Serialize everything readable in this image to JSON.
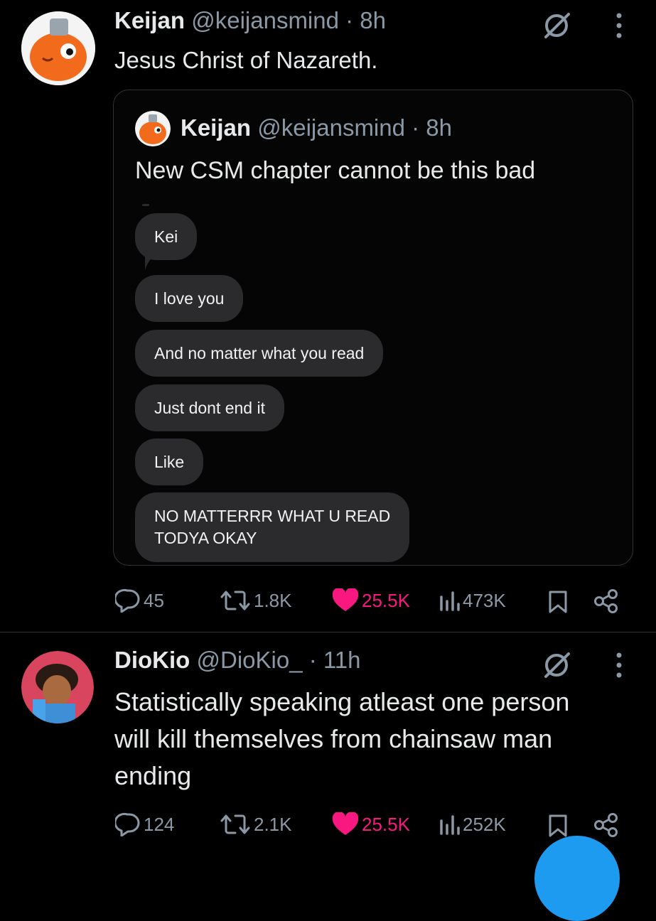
{
  "tweet1": {
    "name": "Keijan",
    "handle": "@keijansmind",
    "time": "· 8h",
    "text": "Jesus Christ of Nazareth.",
    "quote": {
      "name": "Keijan",
      "handle": "@keijansmind",
      "time": "· 8h",
      "text": "New CSM chapter cannot be this bad",
      "messages": [
        "Kei",
        "I love you",
        "And no matter what you read",
        "Just dont end it",
        "Like",
        "NO MATTERRR WHAT U READ",
        "TODYA OKAY"
      ]
    },
    "stats": {
      "replies": "45",
      "retweets": "1.8K",
      "likes": "25.5K",
      "views": "473K"
    }
  },
  "tweet2": {
    "name": "DioKio",
    "handle": "@DioKio_",
    "time": "· 11h",
    "text_lines": [
      "Statistically speaking atleast one person",
      "will kill themselves from chainsaw man",
      "ending"
    ],
    "stats": {
      "replies": "124",
      "retweets": "2.1K",
      "likes": "25.5K",
      "views": "252K"
    }
  },
  "colors": {
    "background": "#000000",
    "like": "#f91880",
    "muted": "#8b98a5",
    "bubble": "#2b2b2d",
    "fab": "#1d9bf0"
  }
}
